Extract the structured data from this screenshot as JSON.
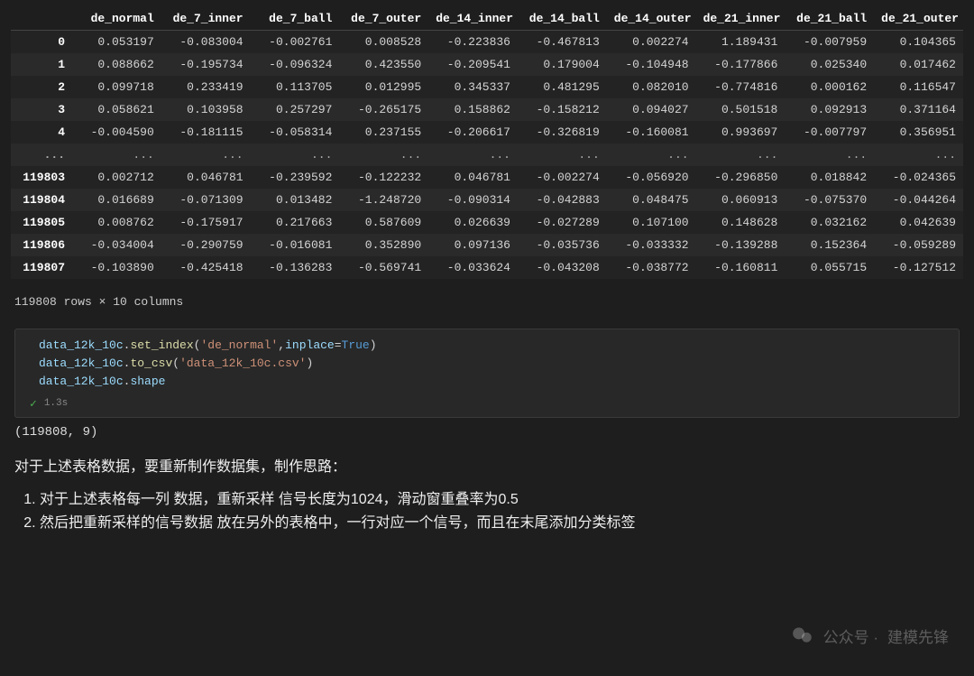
{
  "chart_data": {
    "type": "table",
    "columns": [
      "de_normal",
      "de_7_inner",
      "de_7_ball",
      "de_7_outer",
      "de_14_inner",
      "de_14_ball",
      "de_14_outer",
      "de_21_inner",
      "de_21_ball",
      "de_21_outer"
    ],
    "index_head": [
      0,
      1,
      2,
      3,
      4
    ],
    "index_tail": [
      119803,
      119804,
      119805,
      119806,
      119807
    ],
    "rows_head": [
      [
        0.053197,
        -0.083004,
        -0.002761,
        0.008528,
        -0.223836,
        -0.467813,
        0.002274,
        1.189431,
        -0.007959,
        0.104365
      ],
      [
        0.088662,
        -0.195734,
        -0.096324,
        0.42355,
        -0.209541,
        0.179004,
        -0.104948,
        -0.177866,
        0.02534,
        0.017462
      ],
      [
        0.099718,
        0.233419,
        0.113705,
        0.012995,
        0.345337,
        0.481295,
        0.08201,
        -0.774816,
        0.000162,
        0.116547
      ],
      [
        0.058621,
        0.103958,
        0.257297,
        -0.265175,
        0.158862,
        -0.158212,
        0.094027,
        0.501518,
        0.092913,
        0.371164
      ],
      [
        -0.00459,
        -0.181115,
        -0.058314,
        0.237155,
        -0.206617,
        -0.326819,
        -0.160081,
        0.993697,
        -0.007797,
        0.356951
      ]
    ],
    "rows_tail": [
      [
        0.002712,
        0.046781,
        -0.239592,
        -0.122232,
        0.046781,
        -0.002274,
        -0.05692,
        -0.29685,
        0.018842,
        -0.024365
      ],
      [
        0.016689,
        -0.071309,
        0.013482,
        -1.24872,
        -0.090314,
        -0.042883,
        0.048475,
        0.060913,
        -0.07537,
        -0.044264
      ],
      [
        0.008762,
        -0.175917,
        0.217663,
        0.587609,
        0.026639,
        -0.027289,
        0.1071,
        0.148628,
        0.032162,
        0.042639
      ],
      [
        -0.034004,
        -0.290759,
        -0.016081,
        0.35289,
        0.097136,
        -0.035736,
        -0.033332,
        -0.139288,
        0.152364,
        -0.059289
      ],
      [
        -0.10389,
        -0.425418,
        -0.136283,
        -0.569741,
        -0.033624,
        -0.043208,
        -0.038772,
        -0.160811,
        0.055715,
        -0.127512
      ]
    ],
    "shape_note": "119808 rows × 10 columns"
  },
  "code": {
    "obj": "data_12k_10c",
    "l1_func": "set_index",
    "l1_str": "'de_normal'",
    "l1_arg": "inplace",
    "l1_val": "True",
    "l2_func": "to_csv",
    "l2_str": "'data_12k_10c.csv'",
    "l3_attr": "shape",
    "exec_time": "1.3s"
  },
  "output": "(119808, 9)",
  "narrative": {
    "lead": "对于上述表格数据，要重新制作数据集，制作思路：",
    "item1": "对于上述表格每一列 数据，重新采样 信号长度为1024，滑动窗重叠率为0.5",
    "item2": "然后把重新采样的信号数据 放在另外的表格中，一行对应一个信号，而且在末尾添加分类标签"
  },
  "watermark": {
    "prefix": "公众号 ·",
    "name": "建模先锋"
  }
}
